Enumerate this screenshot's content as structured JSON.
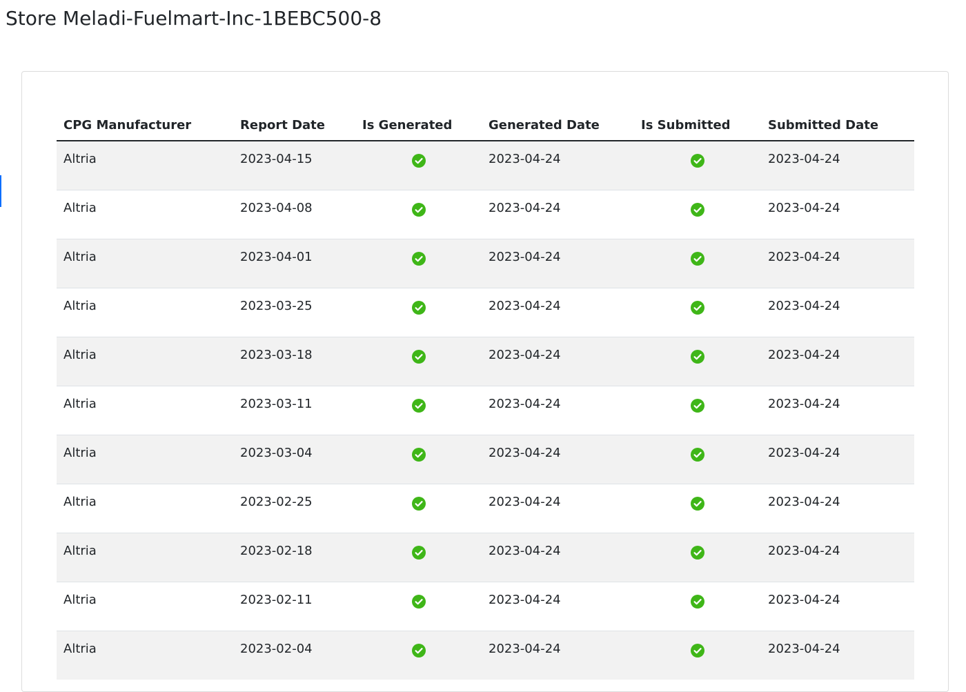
{
  "page": {
    "title": "Store Meladi-Fuelmart-Inc-1BEBC500-8"
  },
  "colors": {
    "check_green": "#3fb618",
    "stripe": "#f2f2f2",
    "accent": "#0d6efd"
  },
  "table": {
    "headers": [
      "CPG Manufacturer",
      "Report Date",
      "Is Generated",
      "Generated Date",
      "Is Submitted",
      "Submitted Date"
    ],
    "rows": [
      {
        "manufacturer": "Altria",
        "report_date": "2023-04-15",
        "is_generated": "check-circle-icon",
        "generated_date": "2023-04-24",
        "is_submitted": "check-circle-icon",
        "submitted_date": "2023-04-24"
      },
      {
        "manufacturer": "Altria",
        "report_date": "2023-04-08",
        "is_generated": "check-circle-icon",
        "generated_date": "2023-04-24",
        "is_submitted": "check-circle-icon",
        "submitted_date": "2023-04-24"
      },
      {
        "manufacturer": "Altria",
        "report_date": "2023-04-01",
        "is_generated": "check-circle-icon",
        "generated_date": "2023-04-24",
        "is_submitted": "check-circle-icon",
        "submitted_date": "2023-04-24"
      },
      {
        "manufacturer": "Altria",
        "report_date": "2023-03-25",
        "is_generated": "check-circle-icon",
        "generated_date": "2023-04-24",
        "is_submitted": "check-circle-icon",
        "submitted_date": "2023-04-24"
      },
      {
        "manufacturer": "Altria",
        "report_date": "2023-03-18",
        "is_generated": "check-circle-icon",
        "generated_date": "2023-04-24",
        "is_submitted": "check-circle-icon",
        "submitted_date": "2023-04-24"
      },
      {
        "manufacturer": "Altria",
        "report_date": "2023-03-11",
        "is_generated": "check-circle-icon",
        "generated_date": "2023-04-24",
        "is_submitted": "check-circle-icon",
        "submitted_date": "2023-04-24"
      },
      {
        "manufacturer": "Altria",
        "report_date": "2023-03-04",
        "is_generated": "check-circle-icon",
        "generated_date": "2023-04-24",
        "is_submitted": "check-circle-icon",
        "submitted_date": "2023-04-24"
      },
      {
        "manufacturer": "Altria",
        "report_date": "2023-02-25",
        "is_generated": "check-circle-icon",
        "generated_date": "2023-04-24",
        "is_submitted": "check-circle-icon",
        "submitted_date": "2023-04-24"
      },
      {
        "manufacturer": "Altria",
        "report_date": "2023-02-18",
        "is_generated": "check-circle-icon",
        "generated_date": "2023-04-24",
        "is_submitted": "check-circle-icon",
        "submitted_date": "2023-04-24"
      },
      {
        "manufacturer": "Altria",
        "report_date": "2023-02-11",
        "is_generated": "check-circle-icon",
        "generated_date": "2023-04-24",
        "is_submitted": "check-circle-icon",
        "submitted_date": "2023-04-24"
      },
      {
        "manufacturer": "Altria",
        "report_date": "2023-02-04",
        "is_generated": "check-circle-icon",
        "generated_date": "2023-04-24",
        "is_submitted": "check-circle-icon",
        "submitted_date": "2023-04-24"
      }
    ]
  }
}
